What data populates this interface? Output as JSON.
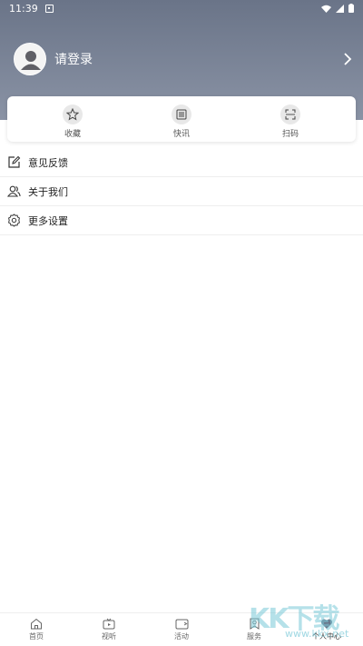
{
  "status_bar": {
    "time": "11:39"
  },
  "profile": {
    "login_text": "请登录"
  },
  "quick_actions": [
    {
      "label": "收藏",
      "icon": "star-icon"
    },
    {
      "label": "快讯",
      "icon": "news-list-icon"
    },
    {
      "label": "扫码",
      "icon": "scan-icon"
    }
  ],
  "menu": [
    {
      "label": "意见反馈",
      "icon": "edit-feedback-icon"
    },
    {
      "label": "关于我们",
      "icon": "users-icon"
    },
    {
      "label": "更多设置",
      "icon": "gear-icon"
    }
  ],
  "tabs": [
    {
      "label": "首页",
      "icon": "home-icon"
    },
    {
      "label": "视听",
      "icon": "tv-icon"
    },
    {
      "label": "活动",
      "icon": "video-camera-icon"
    },
    {
      "label": "服务",
      "icon": "bookmark-icon"
    },
    {
      "label": "个人中心",
      "icon": "heart-icon"
    }
  ],
  "watermark": {
    "big": "KK下载",
    "small": "www.kkx.net"
  },
  "colors": {
    "header_top": "#6a7488",
    "header_bottom": "#8a93a5",
    "active_tab": "#6a7488"
  }
}
